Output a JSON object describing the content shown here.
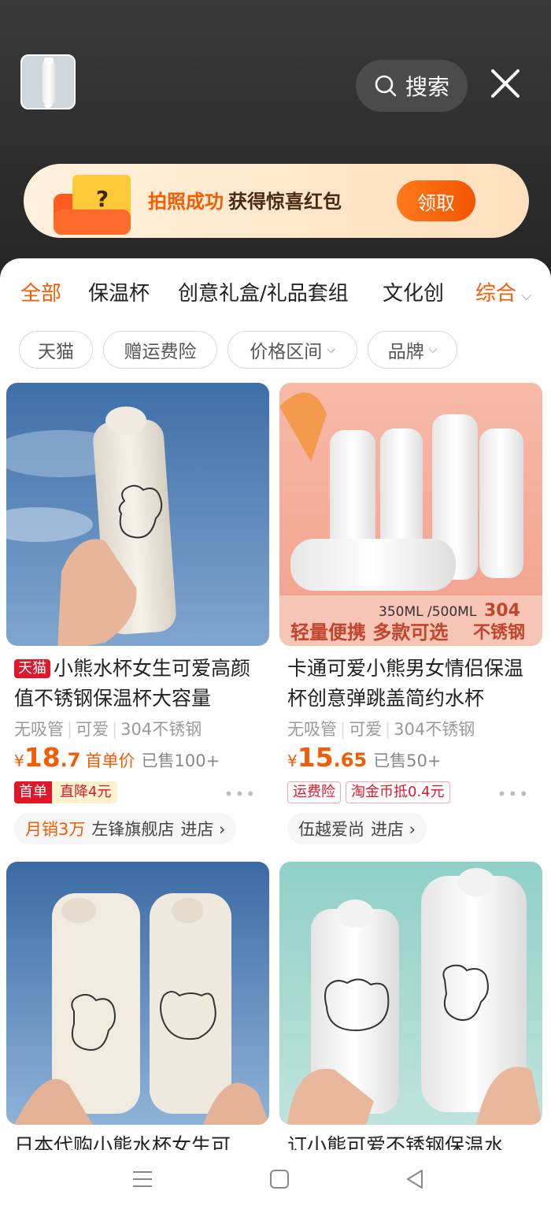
{
  "header": {
    "search_label": "搜索",
    "close_icon": "close-icon",
    "search_icon": "search-icon"
  },
  "banner": {
    "text_highlight": "拍照成功",
    "text_main": "获得惊喜红包",
    "claim_label": "领取",
    "envelope_symbol": "?"
  },
  "categories": [
    "全部",
    "保温杯",
    "创意礼盒/礼品套组",
    "文化创"
  ],
  "sort_label": "综合",
  "filters": [
    {
      "label": "天猫",
      "dropdown": false
    },
    {
      "label": "赠运费险",
      "dropdown": false
    },
    {
      "label": "价格区间",
      "dropdown": true
    },
    {
      "label": "品牌",
      "dropdown": true
    }
  ],
  "products": [
    {
      "badge": "天猫",
      "title": "小熊水杯女生可爱高颜值不锈钢保温杯大容量",
      "attrs": [
        "无吸管",
        "可爱",
        "304不锈钢"
      ],
      "currency": "¥",
      "price_int": "18",
      "price_dec": ".7",
      "price_note": "首单价",
      "sold": "已售100+",
      "tag_first": "首单",
      "tag_drop": "直降4元",
      "shop_highlight": "月销3万",
      "shop_name": "左锋旗舰店",
      "shop_enter": "进店 ›"
    },
    {
      "title": "卡通可爱小熊男女情侣保温杯创意弹跳盖简约水杯",
      "attrs": [
        "无吸管",
        "可爱",
        "304不锈钢"
      ],
      "currency": "¥",
      "price_int": "15",
      "price_dec": ".65",
      "sold": "已售50+",
      "tag_a": "运费险",
      "tag_b": "淘金币抵0.4元",
      "shop_name": "伍越爱尚",
      "shop_enter": "进店 ›",
      "image_text": {
        "capacity": "350ML /500ML",
        "slogan": "轻量便携 多款可选",
        "material_a": "304",
        "material_b": "不锈钢"
      }
    },
    {
      "title_cut": "日本代购小熊水杯女生可"
    },
    {
      "title_cut": "订小熊可爱不锈钢保温水"
    }
  ],
  "colors": {
    "accent": "#f25c05",
    "tmall": "#e0162b"
  }
}
